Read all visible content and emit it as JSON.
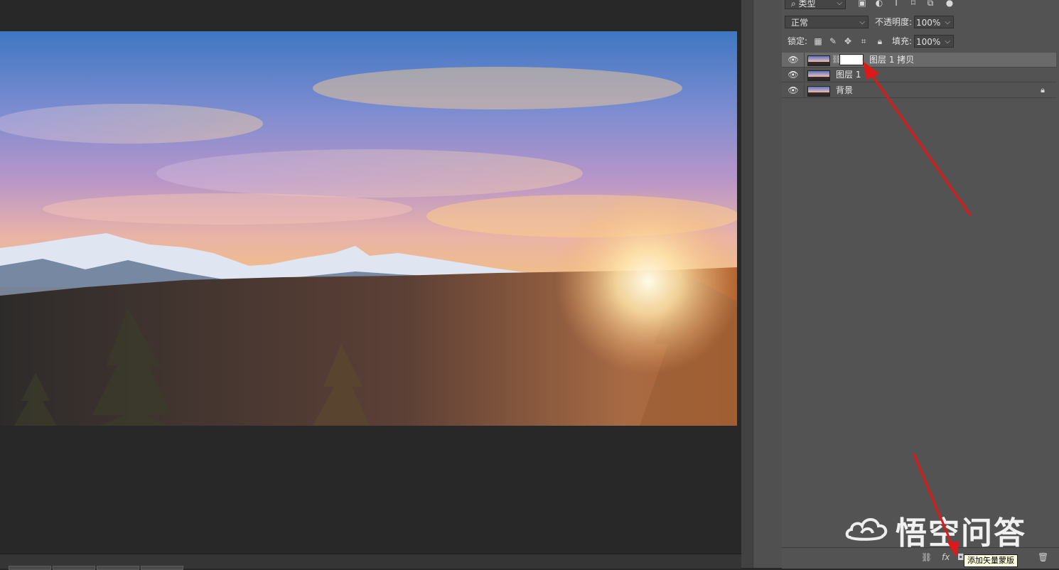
{
  "layers_panel": {
    "filter_label": "类型",
    "blend_mode": "正常",
    "opacity_label": "不透明度:",
    "opacity_value": "100%",
    "lock_label": "锁定:",
    "fill_label": "填充:",
    "fill_value": "100%",
    "layers": [
      {
        "name": "图层 1 拷贝",
        "visible": true,
        "selected": true,
        "has_mask": true,
        "locked": false
      },
      {
        "name": "图层 1",
        "visible": true,
        "selected": false,
        "has_mask": false,
        "locked": false
      },
      {
        "name": "背景",
        "visible": true,
        "selected": false,
        "has_mask": false,
        "locked": true
      }
    ],
    "footer": {
      "fx_label": "fx",
      "tooltip": "添加矢量蒙版"
    }
  },
  "watermark": {
    "text": "悟空问答"
  },
  "colors": {
    "panel_bg": "#535353",
    "workspace_bg": "#282828",
    "selected_row": "#6a6a6a",
    "annotation_arrow": "#e01818"
  }
}
